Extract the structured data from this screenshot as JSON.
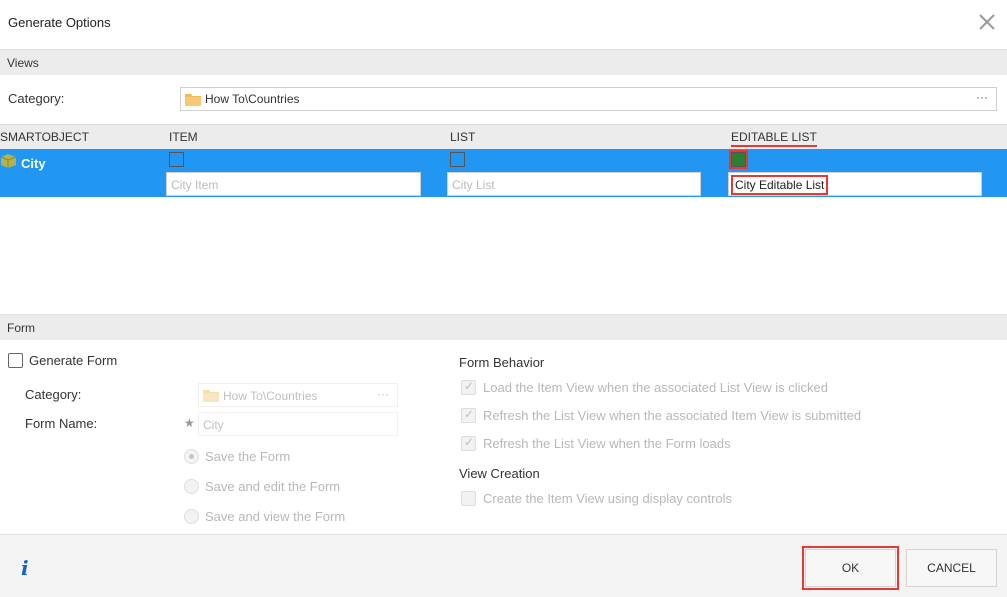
{
  "dialog": {
    "title": "Generate Options"
  },
  "views": {
    "section_label": "Views",
    "category_label": "Category:",
    "category_value": "How To\\Countries",
    "browse_label": "···"
  },
  "grid": {
    "columns": [
      "SMARTOBJECT",
      "ITEM",
      "LIST",
      "EDITABLE LIST"
    ],
    "rows": [
      {
        "smartobject": "City",
        "item": {
          "checked": false,
          "name": "City Item"
        },
        "list": {
          "checked": false,
          "name": "City List"
        },
        "editable_list": {
          "checked": true,
          "name": "City Editable List"
        }
      }
    ]
  },
  "form": {
    "section_label": "Form",
    "generate_label": "Generate Form",
    "generate_checked": false,
    "category_label": "Category:",
    "category_value": "How To\\Countries",
    "browse_label": "···",
    "name_label": "Form Name:",
    "name_value": "City",
    "required_mark": "★",
    "options": [
      {
        "label": "Save the Form",
        "selected": true
      },
      {
        "label": "Save and edit the Form",
        "selected": false
      },
      {
        "label": "Save and view the Form",
        "selected": false
      }
    ],
    "behavior_title": "Form Behavior",
    "behaviors": [
      {
        "label": "Load the Item View when the associated List View is clicked",
        "checked": true
      },
      {
        "label": "Refresh the List View when the associated Item View is submitted",
        "checked": true
      },
      {
        "label": "Refresh the List View when the Form loads",
        "checked": true
      }
    ],
    "view_creation_title": "View Creation",
    "view_creation_option": {
      "label": "Create the Item View using display controls",
      "checked": false
    }
  },
  "footer": {
    "info_icon": "i",
    "ok_label": "OK",
    "cancel_label": "CANCEL"
  },
  "colors": {
    "selection_blue": "#2196f3",
    "highlight_red": "#e53935",
    "info_blue": "#1565c0"
  }
}
